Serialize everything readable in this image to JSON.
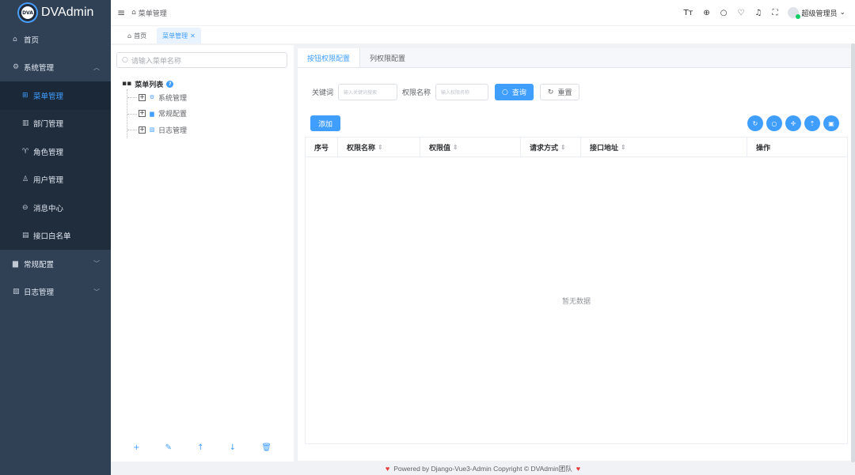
{
  "app": {
    "logo_badge": "DVA",
    "logo_text": "DVAdmin"
  },
  "sidebar": {
    "items": [
      {
        "icon": "home-icon",
        "glyph": "⌂",
        "label": "首页",
        "level": 0
      },
      {
        "icon": "gear-icon",
        "glyph": "⚙",
        "label": "系统管理",
        "level": 0,
        "expanded": true
      },
      {
        "icon": "grid-icon",
        "glyph": "⊞",
        "label": "菜单管理",
        "level": 1,
        "active": true
      },
      {
        "icon": "department-icon",
        "glyph": "▥",
        "label": "部门管理",
        "level": 1
      },
      {
        "icon": "role-icon",
        "glyph": "♈",
        "label": "角色管理",
        "level": 1
      },
      {
        "icon": "user-icon",
        "glyph": "♙",
        "label": "用户管理",
        "level": 1
      },
      {
        "icon": "message-icon",
        "glyph": "⊖",
        "label": "消息中心",
        "level": 1
      },
      {
        "icon": "whitelist-icon",
        "glyph": "▤",
        "label": "接口白名单",
        "level": 1
      },
      {
        "icon": "config-icon",
        "glyph": "▆",
        "label": "常规配置",
        "level": 0
      },
      {
        "icon": "log-icon",
        "glyph": "▧",
        "label": "日志管理",
        "level": 0
      }
    ]
  },
  "header": {
    "breadcrumb": "菜单管理",
    "user_name": "超级管理员"
  },
  "tags": [
    {
      "label": "首页",
      "active": false
    },
    {
      "label": "菜单管理",
      "active": true
    }
  ],
  "tree": {
    "search_placeholder": "请输入菜单名称",
    "root_label": "菜单列表",
    "nodes": [
      {
        "label": "系统管理",
        "icon": "gear-icon",
        "glyph": "⚙"
      },
      {
        "label": "常规配置",
        "icon": "config-icon",
        "glyph": "▆"
      },
      {
        "label": "日志管理",
        "icon": "log-icon",
        "glyph": "▧"
      }
    ]
  },
  "main": {
    "tabs": [
      {
        "label": "按钮权限配置",
        "active": true
      },
      {
        "label": "列权限配置",
        "active": false
      }
    ],
    "filter": {
      "keyword_label": "关键词",
      "keyword_placeholder": "输入关键词搜索",
      "perm_name_label": "权限名称",
      "perm_name_placeholder": "输入权限名称",
      "search_button": "查询",
      "reset_button": "重置"
    },
    "add_button": "添加",
    "table": {
      "columns": [
        "序号",
        "权限名称",
        "权限值",
        "请求方式",
        "接口地址",
        "操作"
      ],
      "empty_text": "暂无数据"
    }
  },
  "footer": {
    "text": "Powered by Django-Vue3-Admin Copyright © DVAdmin团队"
  },
  "colors": {
    "primary": "#409eff",
    "sidebar_bg": "#304156",
    "heart": "#e83a3a"
  }
}
